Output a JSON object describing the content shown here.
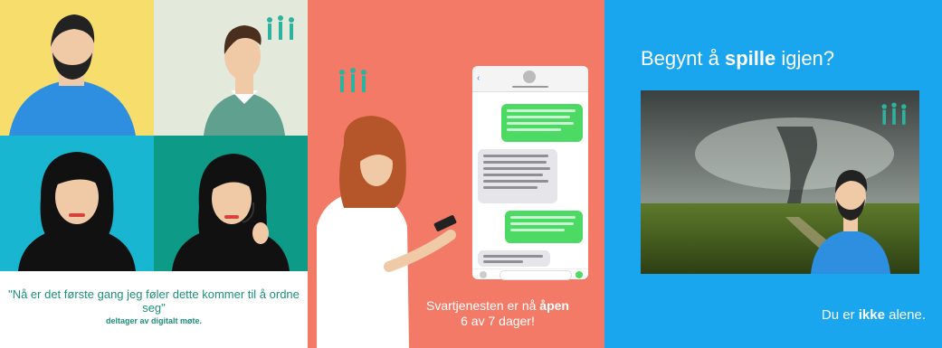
{
  "panel1": {
    "quote": "\"Nå er det første gang jeg føler dette kommer til å ordne seg\"",
    "credit": "deltager av digitalt møte."
  },
  "panel2": {
    "text_pre": "Svartjenesten er nå ",
    "text_bold": "åpen",
    "text_post": "6 av 7 dager!"
  },
  "panel3": {
    "title_pre": "Begynt å ",
    "title_bold": "spille",
    "title_post": " igjen?",
    "footer_pre": "Du er ",
    "footer_bold": "ikke",
    "footer_post": " alene."
  },
  "colors": {
    "teal": "#1d8f7a",
    "coral": "#f27a66",
    "blue": "#1aa6ef",
    "bubble_green": "#4cd964",
    "bubble_gray": "#e5e5ea"
  },
  "icons": [
    "group-logo-icon",
    "person-illustration",
    "phone-illustration",
    "storm-photo"
  ]
}
